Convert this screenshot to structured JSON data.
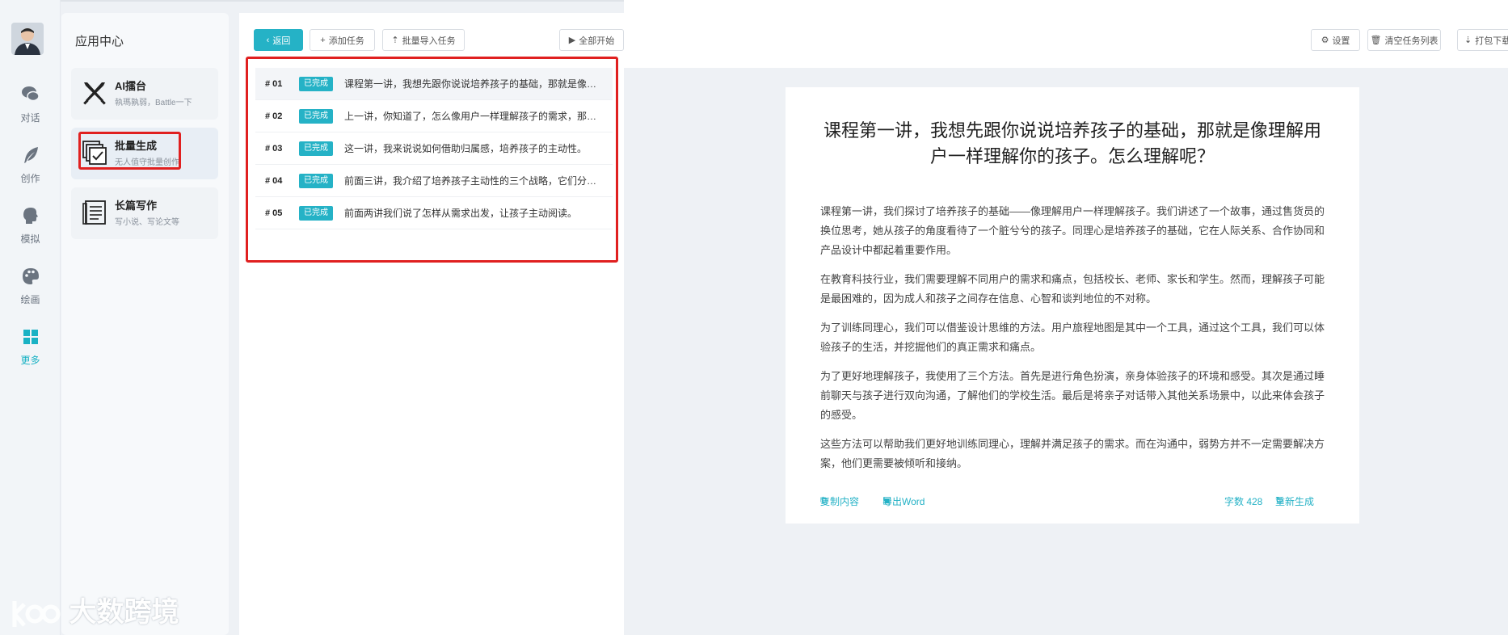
{
  "rail": {
    "items": [
      {
        "label": "对话",
        "icon": "chat-icon"
      },
      {
        "label": "创作",
        "icon": "feather-icon"
      },
      {
        "label": "模拟",
        "icon": "head-icon"
      },
      {
        "label": "绘画",
        "icon": "palette-icon"
      },
      {
        "label": "更多",
        "icon": "grid-icon"
      }
    ]
  },
  "apps": {
    "title": "应用中心",
    "cards": [
      {
        "name": "AI擂台",
        "desc": "執瑪孰弱，Battle一下",
        "icon": "swords-icon"
      },
      {
        "name": "批量生成",
        "desc": "无人值守批量创作",
        "icon": "batch-check-icon"
      },
      {
        "name": "长篇写作",
        "desc": "写小说、写论文等",
        "icon": "document-icon"
      }
    ]
  },
  "toolbar": {
    "back": "返回",
    "add_task": "添加任务",
    "batch_import": "批量导入任务",
    "start_all": "全部开始",
    "settings": "设置",
    "clear_list": "清空任务列表",
    "pack_download": "打包下载"
  },
  "tasks": [
    {
      "num": "# 01",
      "status": "已完成",
      "text": "课程第一讲，我想先跟你说说培养孩子的基础，那就是像理解用户一样理解你的孩子。怎么理解呢？"
    },
    {
      "num": "# 02",
      "status": "已完成",
      "text": "上一讲，你知道了，怎么像用户一样理解孩子的需求，那怎么样才能满足孩子呢？"
    },
    {
      "num": "# 03",
      "status": "已完成",
      "text": "这一讲，我来说说如何借助归属感，培养孩子的主动性。"
    },
    {
      "num": "# 04",
      "status": "已完成",
      "text": "前面三讲，我介绍了培养孩子主动性的三个战略，它们分别是什么呢？"
    },
    {
      "num": "# 05",
      "status": "已完成",
      "text": "前面两讲我们说了怎样从需求出发，让孩子主动阅读。"
    }
  ],
  "document": {
    "title": "课程第一讲，我想先跟你说说培养孩子的基础，那就是像理解用户一样理解你的孩子。怎么理解呢？",
    "paragraphs": [
      "课程第一讲，我们探讨了培养孩子的基础——像理解用户一样理解孩子。我们讲述了一个故事，通过售货员的换位思考，她从孩子的角度看待了一个脏兮兮的孩子。同理心是培养孩子的基础，它在人际关系、合作协同和产品设计中都起着重要作用。",
      "在教育科技行业，我们需要理解不同用户的需求和痛点，包括校长、老师、家长和学生。然而，理解孩子可能是最困难的，因为成人和孩子之间存在信息、心智和谈判地位的不对称。",
      "为了训练同理心，我们可以借鉴设计思维的方法。用户旅程地图是其中一个工具，通过这个工具，我们可以体验孩子的生活，并挖掘他们的真正需求和痛点。",
      "为了更好地理解孩子，我使用了三个方法。首先是进行角色扮演，亲身体验孩子的环境和感受。其次是通过睡前聊天与孩子进行双向沟通，了解他们的学校生活。最后是将亲子对话带入其他关系场景中，以此来体会孩子的感受。",
      "这些方法可以帮助我们更好地训练同理心，理解并满足孩子的需求。而在沟通中，弱势方并不一定需要解决方案，他们更需要被倾听和接纳。"
    ],
    "copy": "复制内容",
    "export": "导出Word",
    "word_count": "字数 428",
    "regenerate": "重新生成"
  },
  "watermark": "大数跨境",
  "colors": {
    "accent": "#25b2c6",
    "highlight": "#e02020"
  }
}
